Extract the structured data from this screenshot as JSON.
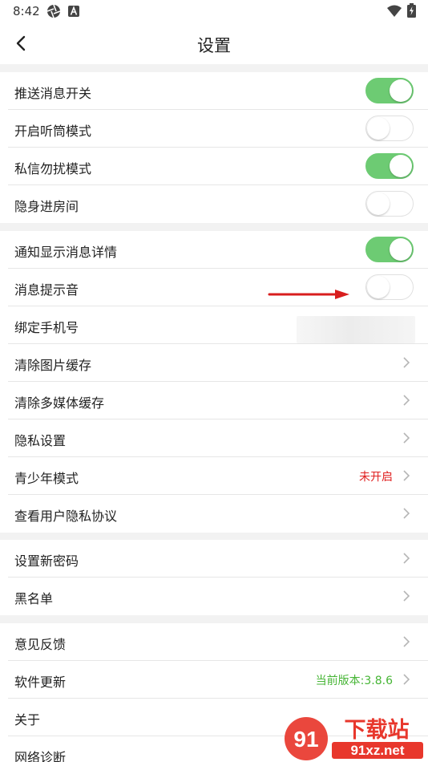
{
  "status": {
    "time": "8:42"
  },
  "header": {
    "title": "设置"
  },
  "groups": [
    {
      "rows": [
        {
          "label": "推送消息开关",
          "type": "toggle",
          "on": true
        },
        {
          "label": "开启听筒模式",
          "type": "toggle",
          "on": false
        },
        {
          "label": "私信勿扰模式",
          "type": "toggle",
          "on": true
        },
        {
          "label": "隐身进房间",
          "type": "toggle",
          "on": false
        }
      ]
    },
    {
      "rows": [
        {
          "label": "通知显示消息详情",
          "type": "toggle",
          "on": true
        },
        {
          "label": "消息提示音",
          "type": "toggle",
          "on": false
        },
        {
          "label": "绑定手机号",
          "type": "phone"
        },
        {
          "label": "清除图片缓存",
          "type": "link"
        },
        {
          "label": "清除多媒体缓存",
          "type": "link"
        },
        {
          "label": "隐私设置",
          "type": "link"
        },
        {
          "label": "青少年模式",
          "type": "link",
          "value": "未开启",
          "value_color": "#e02020"
        },
        {
          "label": "查看用户隐私协议",
          "type": "link"
        }
      ]
    },
    {
      "rows": [
        {
          "label": "设置新密码",
          "type": "link"
        },
        {
          "label": "黑名单",
          "type": "link"
        }
      ]
    },
    {
      "rows": [
        {
          "label": "意见反馈",
          "type": "link"
        },
        {
          "label": "软件更新",
          "type": "link",
          "value": "当前版本:3.8.6",
          "value_color": "#46b535"
        },
        {
          "label": "关于",
          "type": "link"
        },
        {
          "label": "网络诊断",
          "type": "link"
        }
      ]
    }
  ],
  "colors": {
    "toggle_on": "#6dcb73",
    "annotation_arrow": "#d81e1e",
    "background": "#f2f2f2"
  },
  "watermark": {
    "text": "下载站",
    "domain": "91xz.net"
  }
}
